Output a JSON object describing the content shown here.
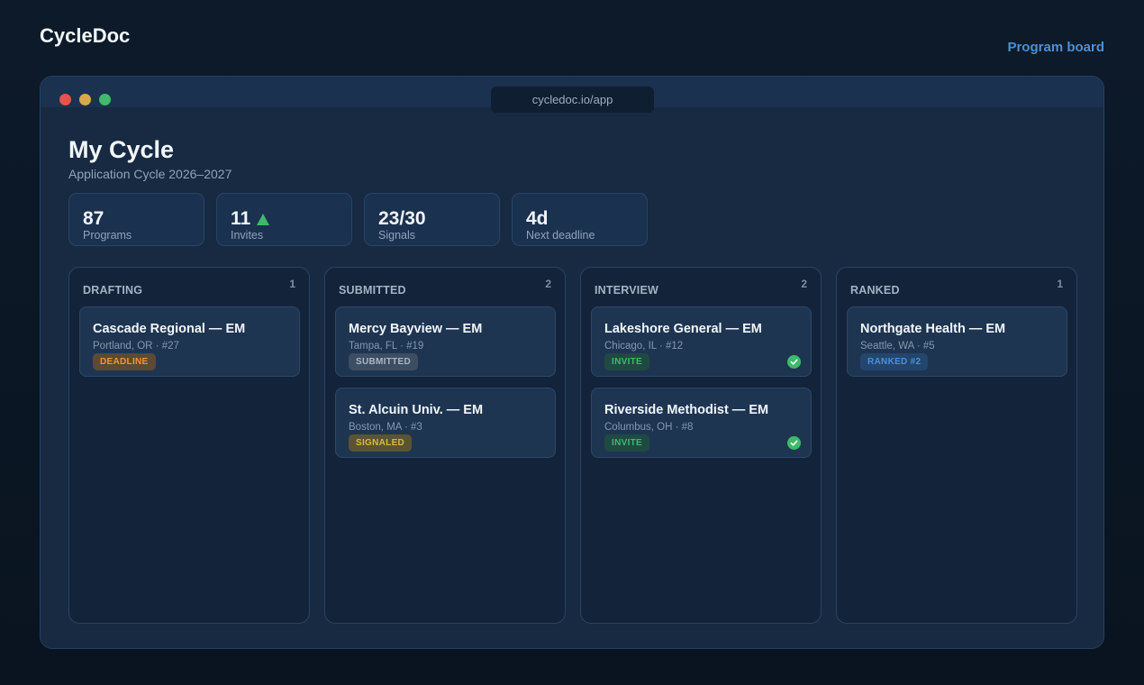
{
  "brand": "CycleDoc",
  "top_nav": {
    "program_board": "Program board"
  },
  "window": {
    "url": "cycledoc.io/app"
  },
  "page": {
    "title": "My Cycle",
    "subtitle": "Application Cycle 2026–2027"
  },
  "stats": [
    {
      "value": "87",
      "label": "Programs"
    },
    {
      "value": "11",
      "label": "Invites",
      "trend": "up"
    },
    {
      "value": "23/30",
      "label": "Signals"
    },
    {
      "value": "4d",
      "label": "Next deadline"
    }
  ],
  "columns": [
    {
      "title": "DRAFTING",
      "count": "1",
      "cards": [
        {
          "title": "Cascade Regional — EM",
          "sub": "Portland, OR · #27",
          "badge": "DEADLINE"
        }
      ]
    },
    {
      "title": "SUBMITTED",
      "count": "2",
      "cards": [
        {
          "title": "Mercy Bayview — EM",
          "sub": "Tampa, FL · #19",
          "badge": "SUBMITTED"
        },
        {
          "title": "St. Alcuin Univ. — EM",
          "sub": "Boston, MA · #3",
          "badge": "SIGNALED"
        }
      ]
    },
    {
      "title": "INTERVIEW",
      "count": "2",
      "cards": [
        {
          "title": "Lakeshore General — EM",
          "sub": "Chicago, IL · #12",
          "badge": "INVITE",
          "icon": "check-circle-icon"
        },
        {
          "title": "Riverside Methodist — EM",
          "sub": "Columbus, OH · #8",
          "badge": "INVITE",
          "icon": "check-circle-icon"
        }
      ]
    },
    {
      "title": "RANKED",
      "count": "1",
      "cards": [
        {
          "title": "Northgate Health — EM",
          "sub": "Seattle, WA · #5",
          "badge": "RANKED #2"
        }
      ]
    }
  ],
  "colors": {
    "background": "#0b1624",
    "accent": "#4a90d9",
    "success": "#3fb96a",
    "warning": "#e79a3c",
    "signal": "#d9ba3a"
  }
}
